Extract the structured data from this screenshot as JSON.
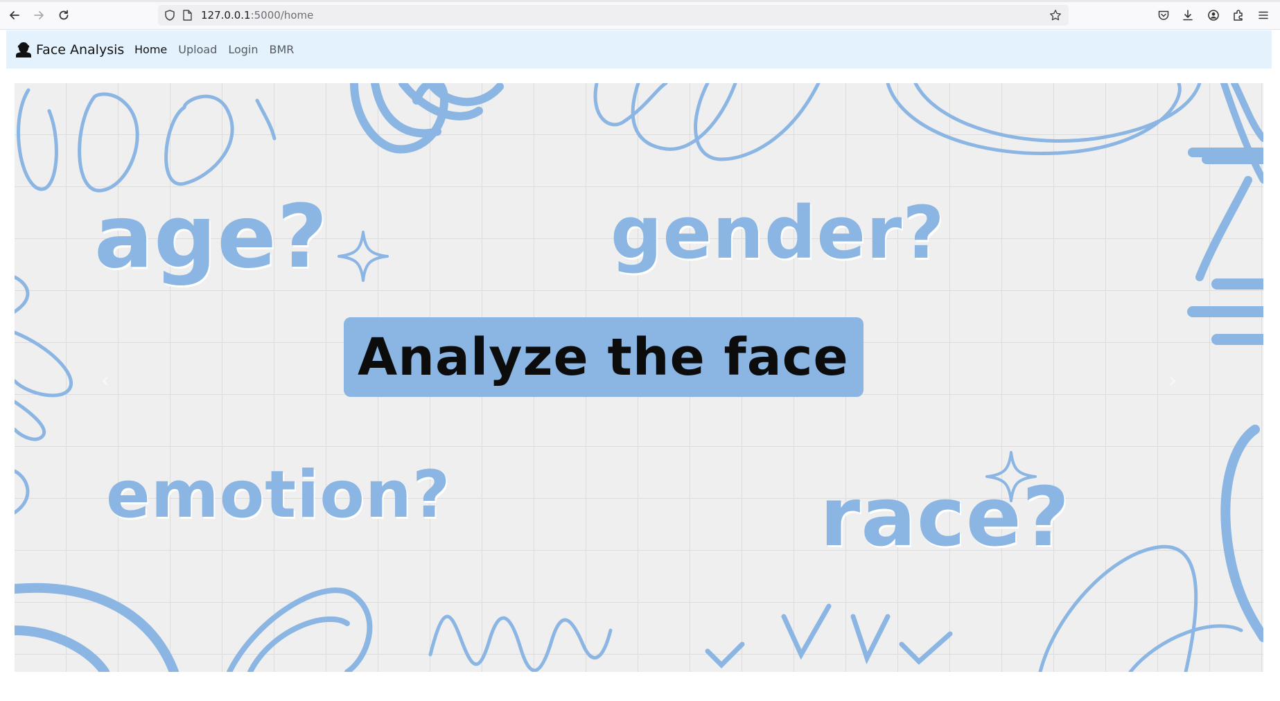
{
  "browser": {
    "url_host": "127.0.0.1",
    "url_rest": ":5000/home",
    "icons": [
      "back-icon",
      "forward-icon",
      "reload-icon",
      "shield-icon",
      "page-icon",
      "bookmark-star-icon",
      "pocket-icon",
      "download-icon",
      "account-icon",
      "extensions-icon",
      "menu-icon"
    ]
  },
  "navbar": {
    "brand": "Face Analysis",
    "links": [
      "Home",
      "Upload",
      "Login",
      "BMR"
    ],
    "active_link": "Home"
  },
  "hero": {
    "words": {
      "age": "age?",
      "gender": "gender?",
      "emotion": "emotion?",
      "race": "race?"
    },
    "cta": "Analyze the face",
    "prev_glyph": "‹",
    "next_glyph": "›"
  },
  "colors": {
    "accent": "#8bb5e2",
    "navbar_bg": "#e3f2fd",
    "hero_bg": "#eeeeee"
  }
}
